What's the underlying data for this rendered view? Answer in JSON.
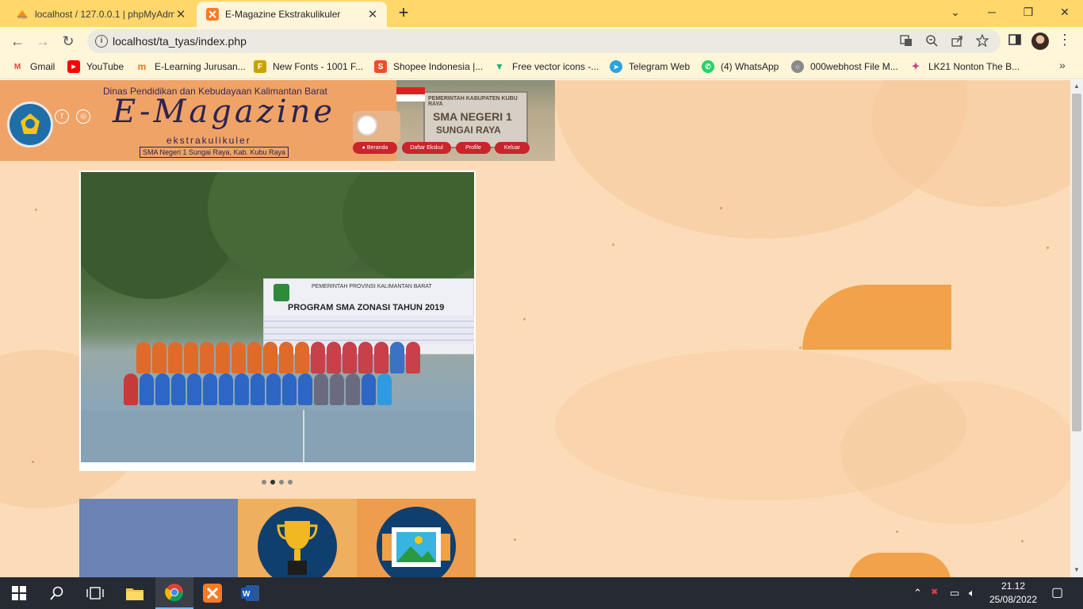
{
  "tabs": [
    {
      "title": "localhost / 127.0.0.1 | phpMyAdmin",
      "active": false
    },
    {
      "title": "E-Magazine Ekstrakulikuler",
      "active": true
    }
  ],
  "tab_close": "✕",
  "new_tab": "+",
  "window": {
    "minimize": "─",
    "maximize": "❐",
    "close": "✕",
    "tab_search": "⌄"
  },
  "nav": {
    "back": "←",
    "forward": "→",
    "reload": "↻"
  },
  "address": {
    "url": "localhost/ta_tyas/index.php",
    "info": "i"
  },
  "bookmarks": [
    {
      "label": "Gmail",
      "color": "#ea4335",
      "glyph": "M"
    },
    {
      "label": "YouTube",
      "color": "#ff0000",
      "glyph": "▶"
    },
    {
      "label": "E-Learning Jurusan...",
      "color": "#e2791f",
      "glyph": "m"
    },
    {
      "label": "New Fonts - 1001 F...",
      "color": "#c9a200",
      "glyph": "F"
    },
    {
      "label": "Shopee Indonesia |...",
      "color": "#ee4d2d",
      "glyph": "S"
    },
    {
      "label": "Free vector icons -...",
      "color": "#19b37b",
      "glyph": "▼"
    },
    {
      "label": "Telegram Web",
      "color": "#2aa3de",
      "glyph": "➤"
    },
    {
      "label": "(4) WhatsApp",
      "color": "#25d366",
      "glyph": "✆"
    },
    {
      "label": "000webhost File M...",
      "color": "#7a7a7a",
      "glyph": "○"
    },
    {
      "label": "LK21 Nonton The B...",
      "color": "#d13f8a",
      "glyph": "✦"
    }
  ],
  "bookmarks_more": "»",
  "site": {
    "dinas": "Dinas Pendidikan dan Kebudayaan Kalimantan Barat",
    "logo_title": "E-Magazine",
    "logo_sub": "ekstrakulikuler",
    "school": "SMA Negeri 1 Sungai Raya, Kab. Kubu Raya",
    "social": [
      "f",
      "◎"
    ],
    "menu": [
      "Beranda",
      "Daftar Ekskul",
      "Profile",
      "Keluar"
    ],
    "sign_l1": "PEMERINTAH KABUPATEN KUBU RAYA",
    "sign_l2": "SMA NEGERI 1",
    "sign_l3": "SUNGAI RAYA",
    "slide_banner_l1": "PEMERINTAH PROVINSI KALIMANTAN BARAT",
    "slide_banner_l2": "PROGRAM SMA ZONASI TAHUN 2019",
    "slide_count": 4,
    "slide_active": 2
  },
  "taskbar": {
    "time": "21.12",
    "date": "25/08/2022"
  },
  "colors": {
    "tabstrip": "#ffd76a",
    "page_bg": "#fcdcb8",
    "banner": "#f0a367",
    "menu_pill": "#c8252c",
    "tile_blue": "#6b83b5",
    "tile_orange": "#eeaf5e",
    "tile_dark": "#0e3f6e",
    "taskbar": "#262a33"
  }
}
